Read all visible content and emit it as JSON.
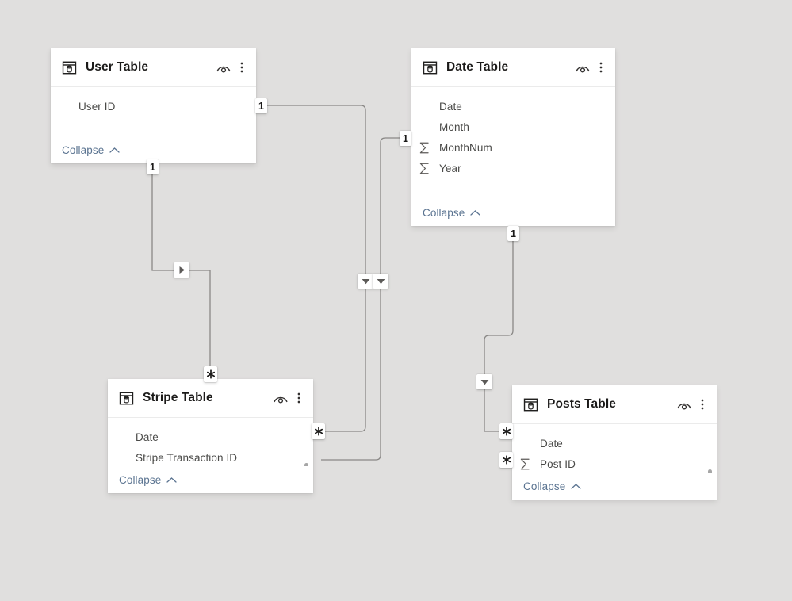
{
  "canvas": {
    "background": "#e0dfde",
    "view_name": "model-view"
  },
  "tables": [
    {
      "id": "user-table",
      "title": "User Table",
      "icon": "table-icon",
      "hide_icon": "eye-icon",
      "more_icon": "more-options-icon",
      "collapse_label": "Collapse",
      "fields": [
        {
          "name": "User ID",
          "type": "text",
          "icon": null
        }
      ],
      "has_scrollbar": false
    },
    {
      "id": "date-table",
      "title": "Date Table",
      "icon": "table-icon",
      "hide_icon": "eye-icon",
      "more_icon": "more-options-icon",
      "collapse_label": "Collapse",
      "fields": [
        {
          "name": "Date",
          "type": "text",
          "icon": null
        },
        {
          "name": "Month",
          "type": "text",
          "icon": null
        },
        {
          "name": "MonthNum",
          "type": "numeric",
          "icon": "sigma-icon"
        },
        {
          "name": "Year",
          "type": "numeric",
          "icon": "sigma-icon"
        }
      ],
      "has_scrollbar": false
    },
    {
      "id": "stripe-table",
      "title": "Stripe Table",
      "icon": "table-icon",
      "hide_icon": "eye-icon",
      "more_icon": "more-options-icon",
      "collapse_label": "Collapse",
      "fields": [
        {
          "name": "Date",
          "type": "text",
          "icon": null
        },
        {
          "name": "Stripe Transaction ID",
          "type": "text",
          "icon": null
        }
      ],
      "has_scrollbar": true
    },
    {
      "id": "posts-table",
      "title": "Posts Table",
      "icon": "table-icon",
      "hide_icon": "eye-icon",
      "more_icon": "more-options-icon",
      "collapse_label": "Collapse",
      "fields": [
        {
          "name": "Date",
          "type": "text",
          "icon": null
        },
        {
          "name": "Post ID",
          "type": "numeric",
          "icon": "sigma-icon"
        }
      ],
      "has_scrollbar": true
    }
  ],
  "relationships": [
    {
      "id": "user-to-stripe",
      "from_table": "User Table",
      "to_table": "Stripe Table",
      "from_cardinality": "1",
      "to_cardinality": "*",
      "cross_filter_direction": "single",
      "direction_icon": "arrow-right-icon"
    },
    {
      "id": "date-to-stripe-left",
      "from_table": "User Table",
      "to_table": "Stripe Table",
      "from_cardinality": "1",
      "to_cardinality": "*",
      "cross_filter_direction": "single",
      "direction_icon": "arrow-down-icon"
    },
    {
      "id": "date-to-stripe",
      "from_table": "Date Table",
      "to_table": "Stripe Table",
      "from_cardinality": "1",
      "to_cardinality": "*",
      "cross_filter_direction": "single",
      "direction_icon": "arrow-down-icon"
    },
    {
      "id": "date-to-posts",
      "from_table": "Date Table",
      "to_table": "Posts Table",
      "from_cardinality": "1",
      "to_cardinality": "*",
      "cross_filter_direction": "single",
      "direction_icon": "arrow-down-icon"
    },
    {
      "id": "stripe-to-posts",
      "from_table": "Stripe Table",
      "to_table": "Posts Table",
      "from_cardinality": "*",
      "to_cardinality": "*",
      "cross_filter_direction": "none",
      "direction_icon": null
    }
  ],
  "badges": {
    "one": "1",
    "many": "*"
  }
}
